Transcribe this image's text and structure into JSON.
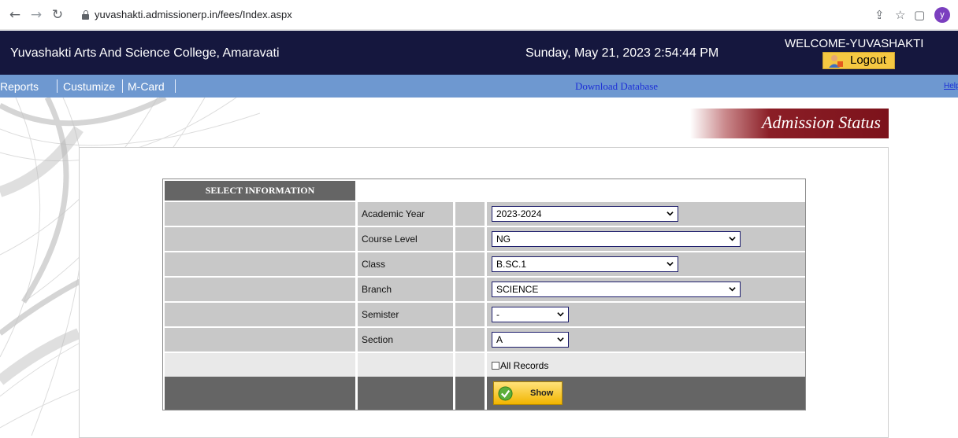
{
  "browser": {
    "url": "yuvashakti.admissionerp.in/fees/Index.aspx",
    "profile_initial": "y"
  },
  "header": {
    "college_name": "Yuvashakti Arts And Science College, Amaravati",
    "datetime": "Sunday, May 21, 2023 2:54:44 PM",
    "welcome": "WELCOME-YUVASHAKTI",
    "logout_label": "Logout"
  },
  "menu": {
    "items": [
      "Reports",
      "Custumize",
      "M-Card"
    ],
    "download_label": "Download Database",
    "help_label": "Help"
  },
  "banner": {
    "title": "Admission Status"
  },
  "form": {
    "heading": "SELECT INFORMATION",
    "fields": [
      {
        "label": "Academic Year",
        "value": "2023-2024"
      },
      {
        "label": "Course Level",
        "value": "NG"
      },
      {
        "label": "Class",
        "value": "B.SC.1"
      },
      {
        "label": "Branch",
        "value": "SCIENCE"
      },
      {
        "label": "Semister",
        "value": "-"
      },
      {
        "label": "Section",
        "value": "A"
      }
    ],
    "all_records_label": "All Records",
    "show_label": "Show"
  },
  "colors": {
    "header_bg": "#15173e",
    "menubar_bg": "#6e98d0",
    "banner_accent": "#7c121b",
    "button_yellow": "#f5c842"
  }
}
